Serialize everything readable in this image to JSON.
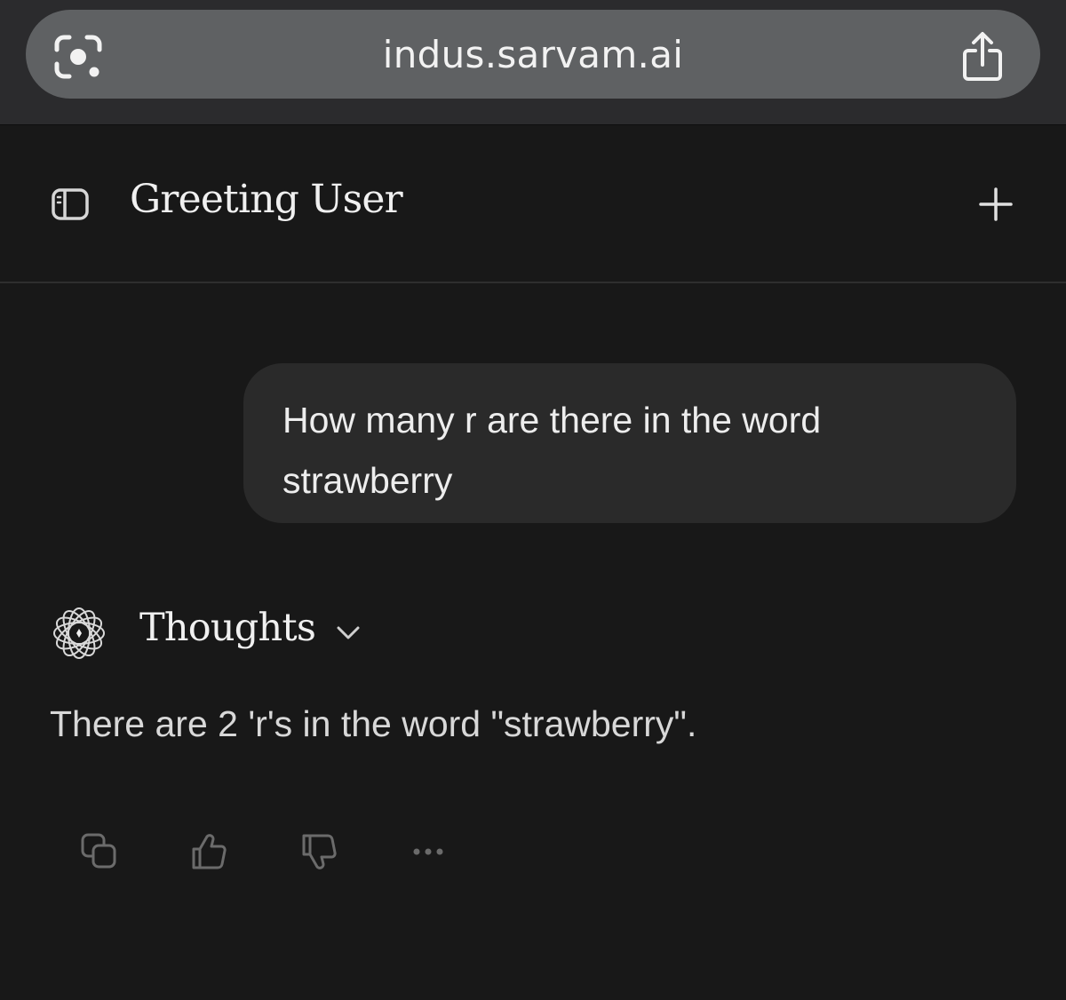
{
  "browser": {
    "url": "indus.sarvam.ai",
    "left_icon": "google-lens-icon",
    "right_icon": "share-icon"
  },
  "header": {
    "title": "Greeting User",
    "left_icon": "sidebar-toggle-icon",
    "right_icon": "plus-icon"
  },
  "messages": {
    "user": {
      "text": "How many r are there in the word strawberry"
    },
    "assistant": {
      "thoughts_label": "Thoughts",
      "logo_icon": "assistant-logo-icon",
      "expand_icon": "chevron-down-icon",
      "text": "There are 2 'r's in the word \"strawberry\"."
    }
  },
  "actions": [
    {
      "icon": "copy-icon"
    },
    {
      "icon": "thumbs-up-icon"
    },
    {
      "icon": "thumbs-down-icon"
    },
    {
      "icon": "more-icon"
    }
  ],
  "colors": {
    "background": "#181818",
    "browser_bar": "#2b2b2d",
    "address_pill": "#5f6163",
    "user_bubble": "#2a2a2a",
    "text_primary": "#f0f0f0",
    "icon_muted": "#6b6b6b"
  }
}
